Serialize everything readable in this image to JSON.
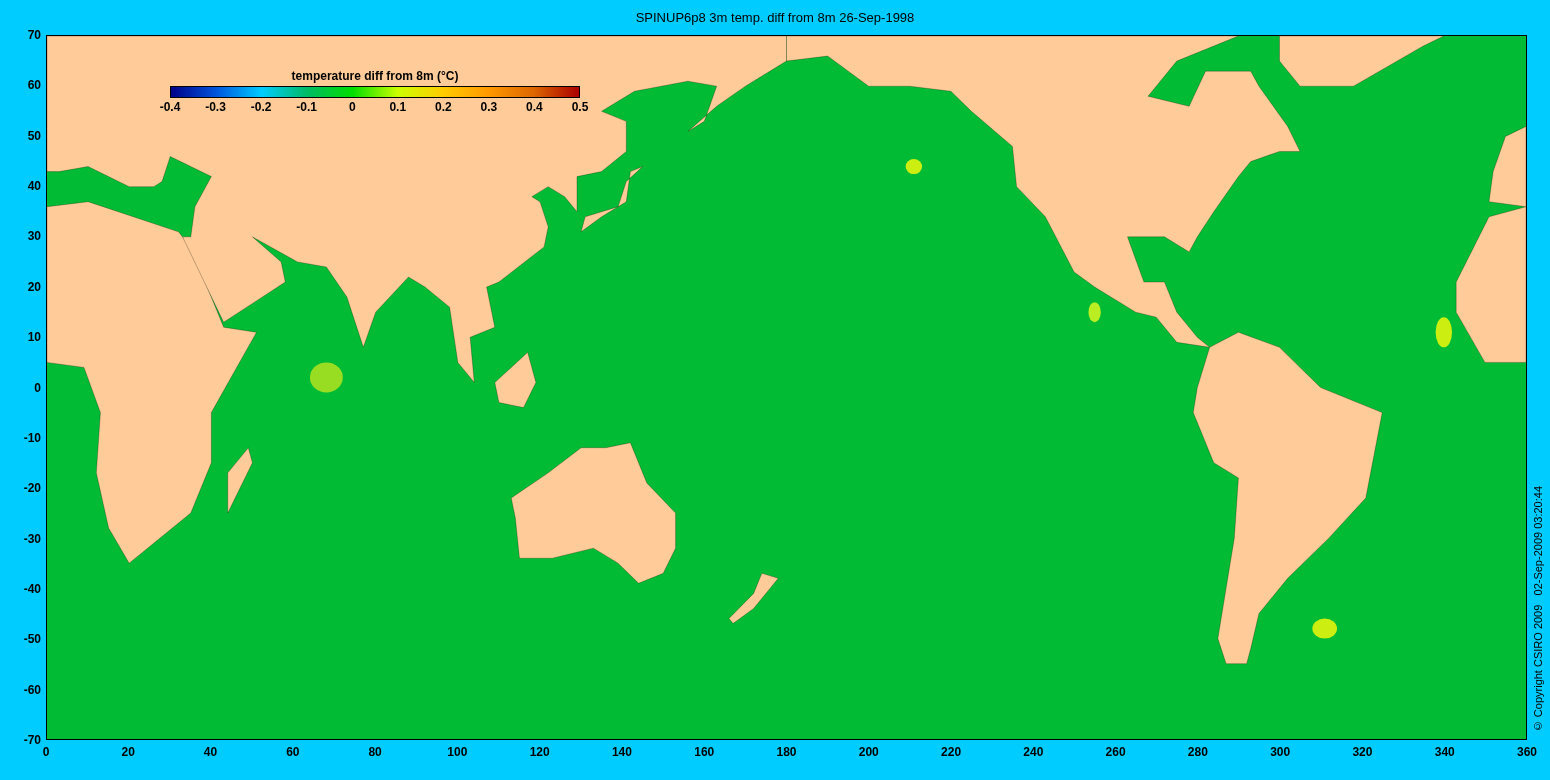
{
  "title": "SPINUP6p8 3m temp.  diff from 8m 26-Sep-1998",
  "colorbar": {
    "title": "temperature  diff from 8m (°C)",
    "ticks": [
      "-0.4",
      "-0.3",
      "-0.2",
      "-0.1",
      "0",
      "0.1",
      "0.2",
      "0.3",
      "0.4",
      "0.5"
    ]
  },
  "y_ticks": [
    "70",
    "60",
    "50",
    "40",
    "30",
    "20",
    "10",
    "0",
    "-10",
    "-20",
    "-30",
    "-40",
    "-50",
    "-60",
    "-70"
  ],
  "x_ticks": [
    "0",
    "20",
    "40",
    "60",
    "80",
    "100",
    "120",
    "140",
    "160",
    "180",
    "200",
    "220",
    "240",
    "260",
    "280",
    "300",
    "320",
    "340",
    "360"
  ],
  "copyright": "© Copyright CSIRO 2009   02-Sep-2009 03:20:44"
}
